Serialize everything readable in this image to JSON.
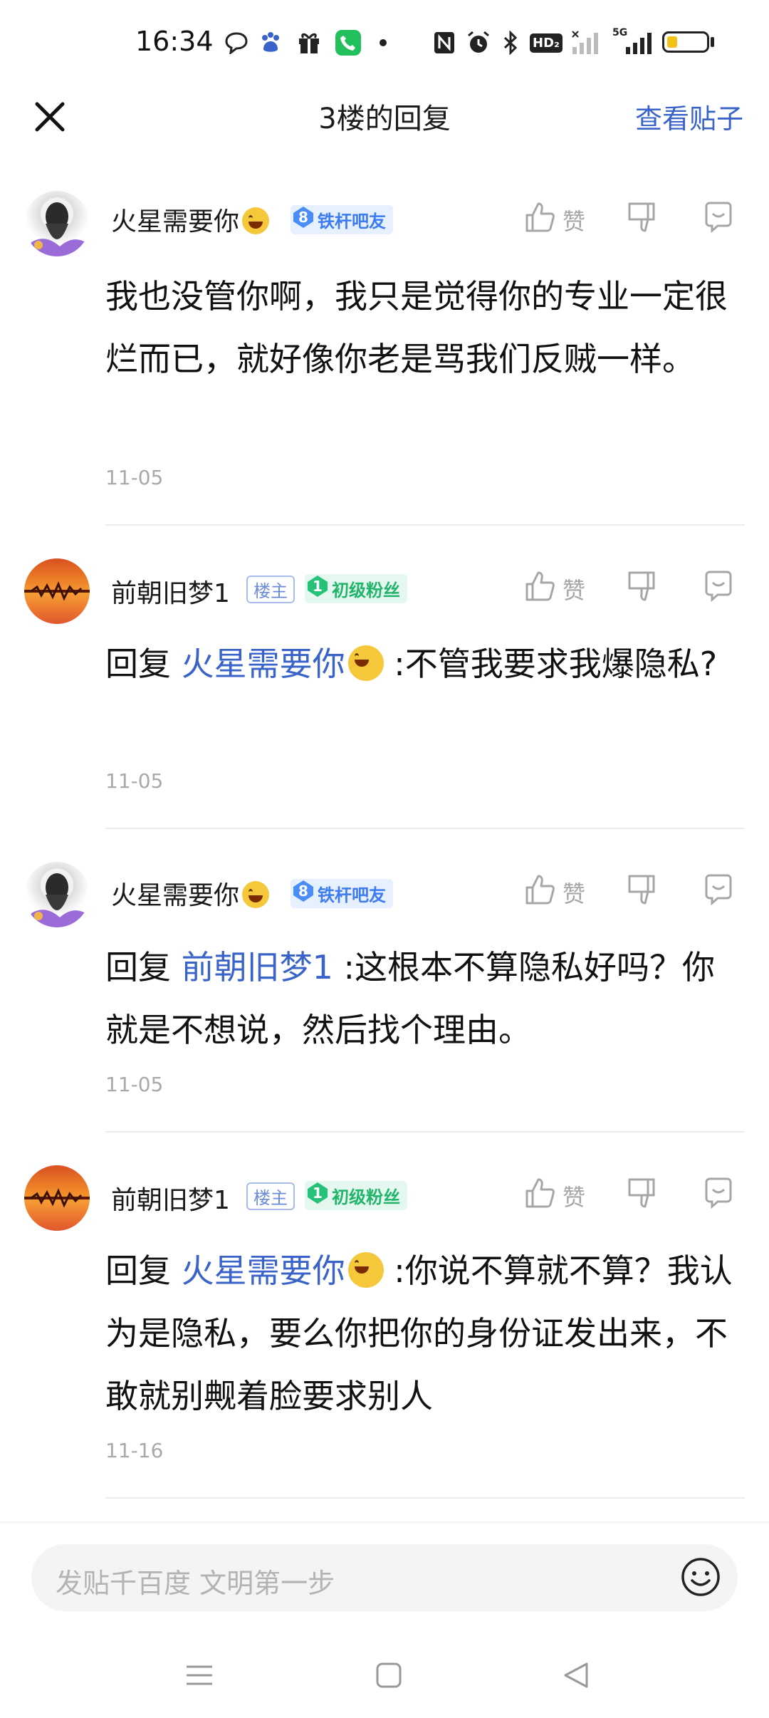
{
  "status_bar": {
    "time": "16:34",
    "icons": [
      "chat-bubble-icon",
      "baidu-paw-icon",
      "gift-icon",
      "phone-icon",
      "dot-icon",
      "nfc-icon",
      "alarm-icon",
      "bluetooth-icon",
      "hd-icon",
      "signal-icon",
      "5g-signal-icon",
      "battery-icon"
    ],
    "hd_label": "HD₂",
    "fiveg_label": "5G",
    "battery_level": 0.25,
    "battery_color": "#f2c21a"
  },
  "header": {
    "title": "3楼的回复",
    "view_post": "查看贴子"
  },
  "colors": {
    "link": "#3a63c9",
    "muted": "#a9a9a9"
  },
  "replies": [
    {
      "username": "火星需要你",
      "has_emoji": true,
      "badge_level": "8",
      "badge_label": "铁杆吧友",
      "like_label": "赞",
      "content": "我也没管你啊，我只是觉得你的专业一定很烂而已，就好像你老是骂我们反贼一样。",
      "date": "11-05"
    },
    {
      "username": "前朝旧梦1",
      "owner_badge": "楼主",
      "badge_level": "1",
      "badge_label": "初级粉丝",
      "like_label": "赞",
      "reply_prefix": "回复",
      "mention": "火星需要你",
      "content": ":不管我要求我爆隐私?",
      "date": "11-05"
    },
    {
      "username": "火星需要你",
      "has_emoji": true,
      "badge_level": "8",
      "badge_label": "铁杆吧友",
      "like_label": "赞",
      "reply_prefix": "回复",
      "mention": "前朝旧梦1",
      "content": ":这根本不算隐私好吗？你就是不想说，然后找个理由。",
      "date": "11-05"
    },
    {
      "username": "前朝旧梦1",
      "owner_badge": "楼主",
      "badge_level": "1",
      "badge_label": "初级粉丝",
      "like_label": "赞",
      "reply_prefix": "回复",
      "mention": "火星需要你",
      "content": ":你说不算就不算？我认为是隐私，要么你把你的身份证发出来，不敢就别觍着脸要求别人",
      "date": "11-16"
    }
  ],
  "input": {
    "placeholder": "发贴千百度 文明第一步"
  },
  "nav": {
    "icons": [
      "menu-icon",
      "home-square-icon",
      "back-triangle-icon"
    ]
  }
}
